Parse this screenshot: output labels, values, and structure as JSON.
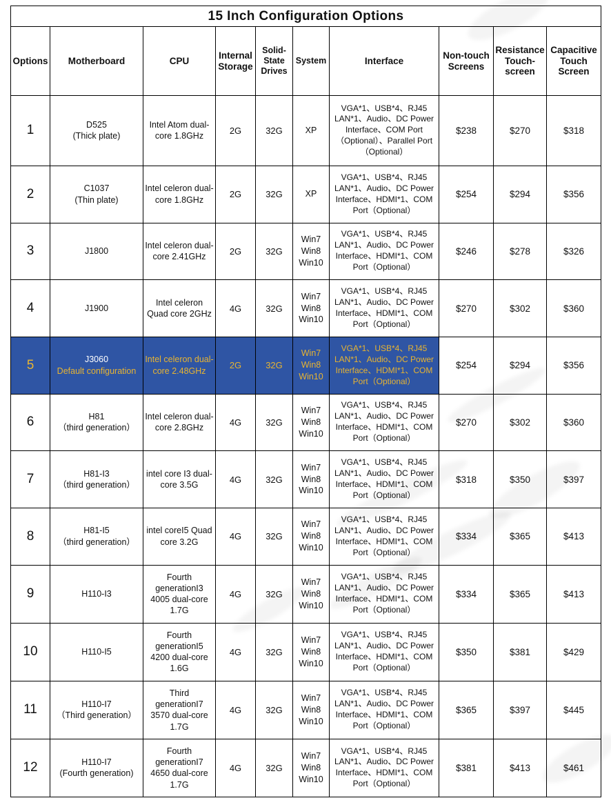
{
  "title": "15 Inch Configuration Options",
  "columns": [
    "Options",
    "Motherboard",
    "CPU",
    "Internal Storage",
    "Solid-State Drives",
    "System",
    "Interface",
    "Non-touch Screens",
    "Resistance Touch-screen",
    "Capacitive Touch Screen"
  ],
  "colors": {
    "highlight_background": "#2f55a4",
    "highlight_text": "#e8b431",
    "highlight_model_text": "#ffffff",
    "border": "#000000",
    "text": "#111111"
  },
  "rows": [
    {
      "option": "1",
      "motherboard": "D525",
      "motherboard_note": "(Thick plate)",
      "cpu": "Intel Atom dual-core 1.8GHz",
      "internal_storage": "2G",
      "ssd": "32G",
      "system": "XP",
      "interface": "VGA*1、USB*4、RJ45 LAN*1、Audio、DC Power Interface、COM Port（Optional）、Parallel Port（Optional）",
      "non_touch": "$238",
      "resistance_touch": "$270",
      "capacitive_touch": "$318",
      "highlight": false
    },
    {
      "option": "2",
      "motherboard": "C1037",
      "motherboard_note": "(Thin plate)",
      "cpu": "Intel celeron dual-core 1.8GHz",
      "internal_storage": "2G",
      "ssd": "32G",
      "system": "XP",
      "interface": "VGA*1、USB*4、RJ45 LAN*1、Audio、DC Power Interface、HDMI*1、COM Port（Optional）",
      "non_touch": "$254",
      "resistance_touch": "$294",
      "capacitive_touch": "$356",
      "highlight": false
    },
    {
      "option": "3",
      "motherboard": "J1800",
      "motherboard_note": "",
      "cpu": "Intel celeron dual-core 2.41GHz",
      "internal_storage": "2G",
      "ssd": "32G",
      "system": "Win7 Win8 Win10",
      "interface": "VGA*1、USB*4、RJ45 LAN*1、Audio、DC Power Interface、HDMI*1、COM Port（Optional）",
      "non_touch": "$246",
      "resistance_touch": "$278",
      "capacitive_touch": "$326",
      "highlight": false
    },
    {
      "option": "4",
      "motherboard": "J1900",
      "motherboard_note": "",
      "cpu": "Intel celeron Quad core 2GHz",
      "internal_storage": "4G",
      "ssd": "32G",
      "system": "Win7 Win8 Win10",
      "interface": "VGA*1、USB*4、RJ45 LAN*1、Audio、DC Power Interface、HDMI*1、COM Port（Optional）",
      "non_touch": "$270",
      "resistance_touch": "$302",
      "capacitive_touch": "$360",
      "highlight": false
    },
    {
      "option": "5",
      "motherboard": "J3060",
      "motherboard_note": "Default configuration",
      "cpu": "Intel celeron dual-core  2.48GHz",
      "internal_storage": "2G",
      "ssd": "32G",
      "system": "Win7 Win8 Win10",
      "interface": "VGA*1、USB*4、RJ45 LAN*1、Audio、DC Power Interface、HDMI*1、COM Port（Optional）",
      "non_touch": "$254",
      "resistance_touch": "$294",
      "capacitive_touch": "$356",
      "highlight": true
    },
    {
      "option": "6",
      "motherboard": "H81",
      "motherboard_note": "（third generation）",
      "cpu": "Intel celeron dual-core 2.8GHz",
      "internal_storage": "4G",
      "ssd": "32G",
      "system": "Win7 Win8 Win10",
      "interface": "VGA*1、USB*4、RJ45 LAN*1、Audio、DC Power Interface、HDMI*1、COM Port（Optional）",
      "non_touch": "$270",
      "resistance_touch": "$302",
      "capacitive_touch": "$360",
      "highlight": false
    },
    {
      "option": "7",
      "motherboard": "H81-I3",
      "motherboard_note": "（third generation）",
      "cpu": "intel core I3 dual-core 3.5G",
      "internal_storage": "4G",
      "ssd": "32G",
      "system": "Win7 Win8 Win10",
      "interface": "VGA*1、USB*4、RJ45 LAN*1、Audio、DC Power Interface、HDMI*1、COM Port（Optional）",
      "non_touch": "$318",
      "resistance_touch": "$350",
      "capacitive_touch": "$397",
      "highlight": false
    },
    {
      "option": "8",
      "motherboard": "H81-I5",
      "motherboard_note": "（third generation）",
      "cpu": "intel coreI5 Quad core 3.2G",
      "internal_storage": "4G",
      "ssd": "32G",
      "system": "Win7 Win8 Win10",
      "interface": "VGA*1、USB*4、RJ45 LAN*1、Audio、DC Power Interface、HDMI*1、COM Port（Optional）",
      "non_touch": "$334",
      "resistance_touch": "$365",
      "capacitive_touch": "$413",
      "highlight": false
    },
    {
      "option": "9",
      "motherboard": "H110-I3",
      "motherboard_note": "",
      "cpu": "Fourth generationI3 4005 dual-core 1.7G",
      "internal_storage": "4G",
      "ssd": "32G",
      "system": "Win7 Win8 Win10",
      "interface": "VGA*1、USB*4、RJ45 LAN*1、Audio、DC Power Interface、HDMI*1、COM Port（Optional）",
      "non_touch": "$334",
      "resistance_touch": "$365",
      "capacitive_touch": "$413",
      "highlight": false
    },
    {
      "option": "10",
      "motherboard": "H110-I5",
      "motherboard_note": "",
      "cpu": "Fourth generationI5 4200 dual-core 1.6G",
      "internal_storage": "4G",
      "ssd": "32G",
      "system": "Win7 Win8 Win10",
      "interface": "VGA*1、USB*4、RJ45 LAN*1、Audio、DC Power Interface、HDMI*1、COM Port（Optional）",
      "non_touch": "$350",
      "resistance_touch": "$381",
      "capacitive_touch": "$429",
      "highlight": false
    },
    {
      "option": "11",
      "motherboard": "H110-I7",
      "motherboard_note": "（Third generation）",
      "cpu": "Third generationI7 3570 dual-core 1.7G",
      "internal_storage": "4G",
      "ssd": "32G",
      "system": "Win7 Win8 Win10",
      "interface": "VGA*1、USB*4、RJ45 LAN*1、Audio、DC Power Interface、HDMI*1、COM Port（Optional）",
      "non_touch": "$365",
      "resistance_touch": "$397",
      "capacitive_touch": "$445",
      "highlight": false
    },
    {
      "option": "12",
      "motherboard": "H110-I7",
      "motherboard_note": "(Fourth generation)",
      "cpu": "Fourth generationI7 4650 dual-core 1.7G",
      "internal_storage": "4G",
      "ssd": "32G",
      "system": "Win7 Win8 Win10",
      "interface": "VGA*1、USB*4、RJ45 LAN*1、Audio、DC Power Interface、HDMI*1、COM Port（Optional）",
      "non_touch": "$381",
      "resistance_touch": "$413",
      "capacitive_touch": "$461",
      "highlight": false
    }
  ]
}
